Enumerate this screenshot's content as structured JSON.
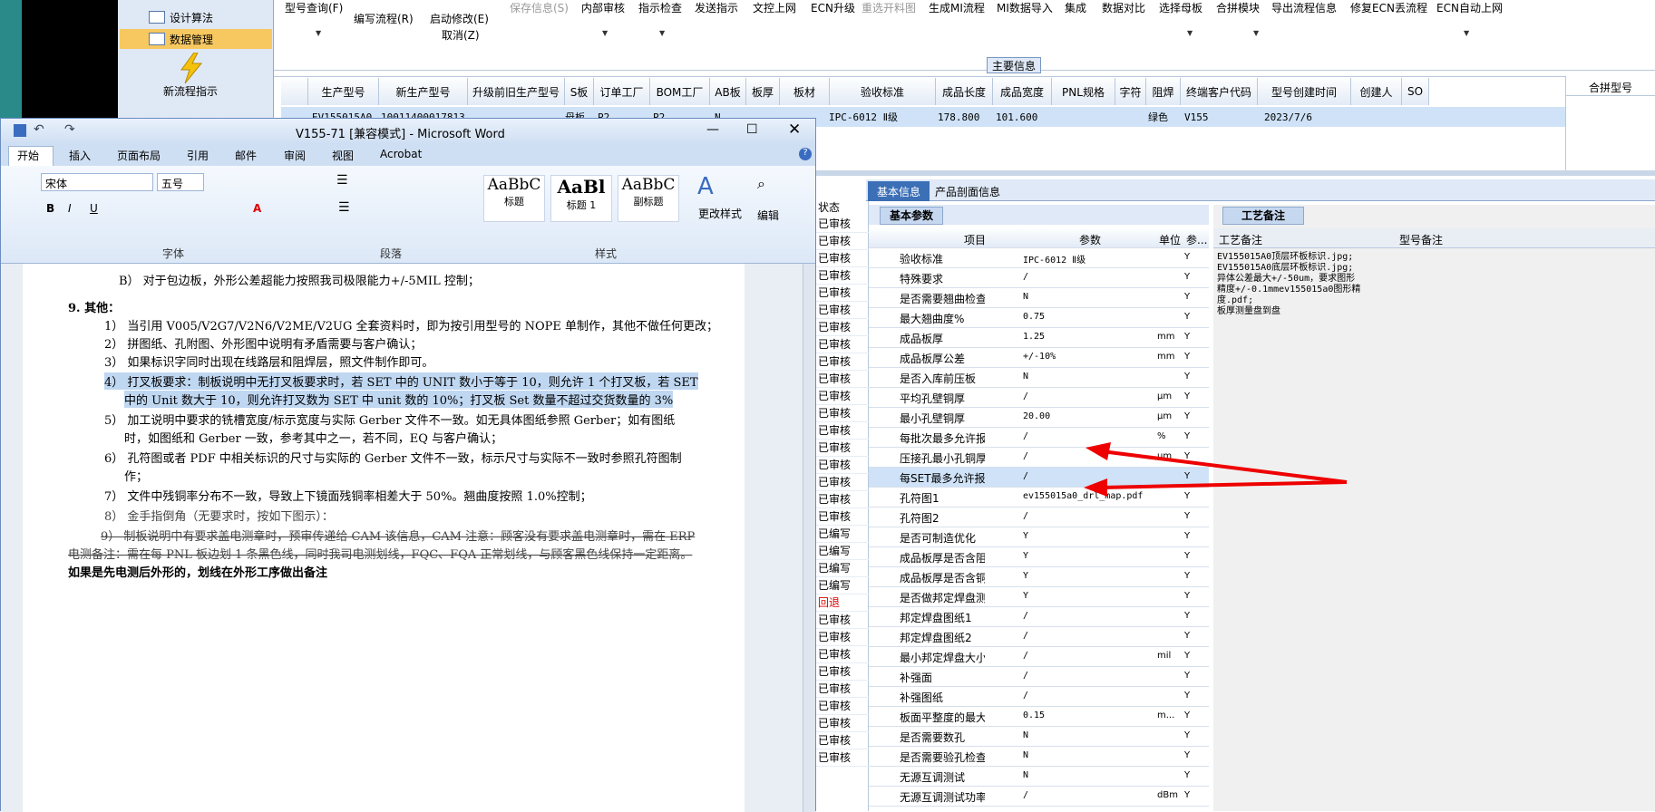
{
  "left_nav": {
    "items": [
      {
        "label": "设计算法"
      },
      {
        "label": "数据管理"
      },
      {
        "label": "新流程指示"
      }
    ]
  },
  "toolbar": {
    "items": [
      {
        "label": "型号查询(F)"
      },
      {
        "label": "编写流程(R)"
      },
      {
        "label": "启动修改(E)"
      },
      {
        "label": "保存信息(S)"
      },
      {
        "label": "内部审核"
      },
      {
        "label": "指示检查"
      },
      {
        "label": "发送指示"
      },
      {
        "label": "文控上网"
      },
      {
        "label": "ECN升级"
      },
      {
        "label": "重选开料图"
      },
      {
        "label": "生成MI流程"
      },
      {
        "label": "MI数据导入"
      },
      {
        "label": "集成"
      },
      {
        "label": "数据对比"
      },
      {
        "label": "选择母板"
      },
      {
        "label": "合拼模块"
      },
      {
        "label": "导出流程信息"
      },
      {
        "label": "修复ECN丢流程"
      },
      {
        "label": "ECN自动上网"
      }
    ],
    "cancel_label": "取消(Z)"
  },
  "main_info_label": "主要信息",
  "merge_label": "合拼型号",
  "grid": {
    "headers": [
      "生产型号",
      "新生产型号",
      "升级前旧生产型号",
      "S板",
      "订单工厂",
      "BOM工厂",
      "AB板",
      "板厚",
      "板材",
      "验收标准",
      "成品长度",
      "成品宽度",
      "PNL规格",
      "字符",
      "阻焊",
      "终端客户代码",
      "型号创建时间",
      "创建人",
      "SO"
    ],
    "row": [
      "EV155015A0",
      "10011400017813",
      "",
      "母板",
      "P2",
      "P2",
      "N",
      "",
      "",
      "IPC-6012 Ⅱ级",
      "178.800",
      "101.600",
      "",
      "",
      "绿色",
      "V155",
      "2023/7/6",
      "",
      ""
    ]
  },
  "word": {
    "title": "V155-71 [兼容模式] - Microsoft Word",
    "tabs": [
      "开始",
      "插入",
      "页面布局",
      "引用",
      "邮件",
      "审阅",
      "视图",
      "Acrobat"
    ],
    "font_name": "宋体",
    "font_size": "五号",
    "groups": [
      "字体",
      "段落",
      "样式",
      "编辑"
    ],
    "styles": [
      {
        "sample": "AaBbC",
        "name": "标题"
      },
      {
        "sample": "AaBl",
        "name": "标题 1"
      },
      {
        "sample": "AaBbC",
        "name": "副标题"
      }
    ],
    "change_style": "更改样式",
    "edit": "编辑",
    "lines": [
      "B） 对于包边板，外形公差超能力按照我司极限能力+/-5MIL 控制；",
      "9.  其他：",
      "1） 当引用 V005/V2G7/V2N6/V2ME/V2UG 全套资料时，即为按引用型号的 NOPE 单制作，其他不做任何更改；",
      "2） 拼图纸、孔附图、外形图中说明有矛盾需要与客户确认；",
      "3） 如果标识字同时出现在线路层和阻焊层，照文件制作即可。",
      "4） 打叉板要求：制板说明中无打叉板要求时，若 SET 中的 UNIT 数小于等于 10，则允许 1 个打叉板，若 SET",
      "中的 Unit 数大于 10，则允许打叉数为 SET 中 unit 数的 10%；打叉板 Set 数量不超过交货数量的 3%",
      "5） 加工说明中要求的铣槽宽度/标示宽度与实际 Gerber 文件不一致。如无具体图纸参照 Gerber；如有图纸",
      "时，如图纸和 Gerber 一致，参考其中之一，若不同，EQ 与客户确认；",
      "6） 孔符图或者 PDF 中相关标识的尺寸与实际的 Gerber 文件不一致，标示尺寸与实际不一致时参照孔符图制",
      "作；",
      "7） 文件中残铜率分布不一致，导致上下镜面残铜率相差大于 50%。翘曲度按照 1.0%控制；",
      "8） 金手指倒角（无要求时，按如下图示）：",
      "9） 制板说明中有要求盖电测章时，预审传递给 CAM 该信息，CAM 注意：顾客没有要求盖电测章时，需在 ERP",
      "电测备注：需在每 PNL 板边划 1 条黑色线，同时我司电测划线，FQC、FQA 正常划线，与顾客黑色线保持一定距离。",
      "如果是先电测后外形的，划线在外形工序做出备注"
    ]
  },
  "status_col": {
    "header": "状态",
    "items": [
      "已审核",
      "已审核",
      "已审核",
      "已审核",
      "已审核",
      "已审核",
      "已审核",
      "已审核",
      "已审核",
      "已审核",
      "已审核",
      "已审核",
      "已审核",
      "已审核",
      "已审核",
      "已审核",
      "已审核",
      "已审核",
      "已编写",
      "已编写",
      "已编写",
      "已编写",
      "回退",
      "已审核",
      "已审核",
      "已审核",
      "已审核",
      "已审核",
      "已审核",
      "已审核",
      "已审核",
      "已审核"
    ]
  },
  "right_tabs": [
    "基本信息",
    "产品剖面信息"
  ],
  "basic_params": {
    "title": "基本参数",
    "col_item": "项目",
    "col_param": "参数",
    "col_unit": "单位",
    "col_extra": "参...",
    "rows": [
      {
        "k": "验收标准",
        "v": "IPC-6012 Ⅱ级",
        "u": "",
        "y": "Y"
      },
      {
        "k": "特殊要求",
        "v": "/",
        "u": "",
        "y": "Y"
      },
      {
        "k": "是否需要翘曲检查",
        "v": "N",
        "u": "",
        "y": "Y"
      },
      {
        "k": "最大翘曲度%",
        "v": "0.75",
        "u": "",
        "y": "Y"
      },
      {
        "k": "成品板厚",
        "v": "1.25",
        "u": "mm",
        "y": "Y"
      },
      {
        "k": "成品板厚公差",
        "v": "+/-10%",
        "u": "mm",
        "y": "Y"
      },
      {
        "k": "是否入库前压板",
        "v": "N",
        "u": "",
        "y": "Y"
      },
      {
        "k": "平均孔壁铜厚",
        "v": "/",
        "u": "μm",
        "y": "Y"
      },
      {
        "k": "最小孔壁铜厚",
        "v": "20.00",
        "u": "μm",
        "y": "Y"
      },
      {
        "k": "每批次最多允许报废SET",
        "v": "/",
        "u": "%",
        "y": "Y"
      },
      {
        "k": "压接孔最小孔铜厚",
        "v": "/",
        "u": "μm",
        "y": "Y"
      },
      {
        "k": "每SET最多允许报废单元",
        "v": "/",
        "u": "",
        "y": "Y"
      },
      {
        "k": "孔符图1",
        "v": "ev155015a0_drl_map.pdf",
        "u": "",
        "y": "Y"
      },
      {
        "k": "孔符图2",
        "v": "/",
        "u": "",
        "y": "Y"
      },
      {
        "k": "是否可制造优化",
        "v": "Y",
        "u": "",
        "y": "Y"
      },
      {
        "k": "成品板厚是否含阻焊",
        "v": "Y",
        "u": "",
        "y": "Y"
      },
      {
        "k": "成品板厚是否含铜厚",
        "v": "Y",
        "u": "",
        "y": "Y"
      },
      {
        "k": "是否做邦定焊盘测试",
        "v": "Y",
        "u": "",
        "y": "Y"
      },
      {
        "k": "邦定焊盘图纸1",
        "v": "/",
        "u": "",
        "y": "Y"
      },
      {
        "k": "邦定焊盘图纸2",
        "v": "/",
        "u": "",
        "y": "Y"
      },
      {
        "k": "最小邦定焊盘大小",
        "v": "/",
        "u": "mil",
        "y": "Y"
      },
      {
        "k": "补强面",
        "v": "/",
        "u": "",
        "y": "Y"
      },
      {
        "k": "补强图纸",
        "v": "/",
        "u": "",
        "y": "Y"
      },
      {
        "k": "板面平整度的最大极差",
        "v": "0.15",
        "u": "m...",
        "y": "Y"
      },
      {
        "k": "是否需要数孔",
        "v": "N",
        "u": "",
        "y": "Y"
      },
      {
        "k": "是否需要验孔检查",
        "v": "N",
        "u": "",
        "y": "Y"
      },
      {
        "k": "无源互调测试",
        "v": "N",
        "u": "",
        "y": "Y"
      },
      {
        "k": "无源互调测试功率",
        "v": "/",
        "u": "dBm",
        "y": "Y"
      }
    ]
  },
  "craft": {
    "title": "工艺备注",
    "col1": "工艺备注",
    "col2": "型号备注",
    "lines": [
      "EV155015A0顶层环板标识.jpg;",
      "EV155015A0底层环板标识.jpg;",
      "异体公差最大+/-50um，要求图形",
      "精度+/-0.1mmev155015a0图形精",
      "度.pdf;",
      "板厚测量盘到盘"
    ]
  }
}
